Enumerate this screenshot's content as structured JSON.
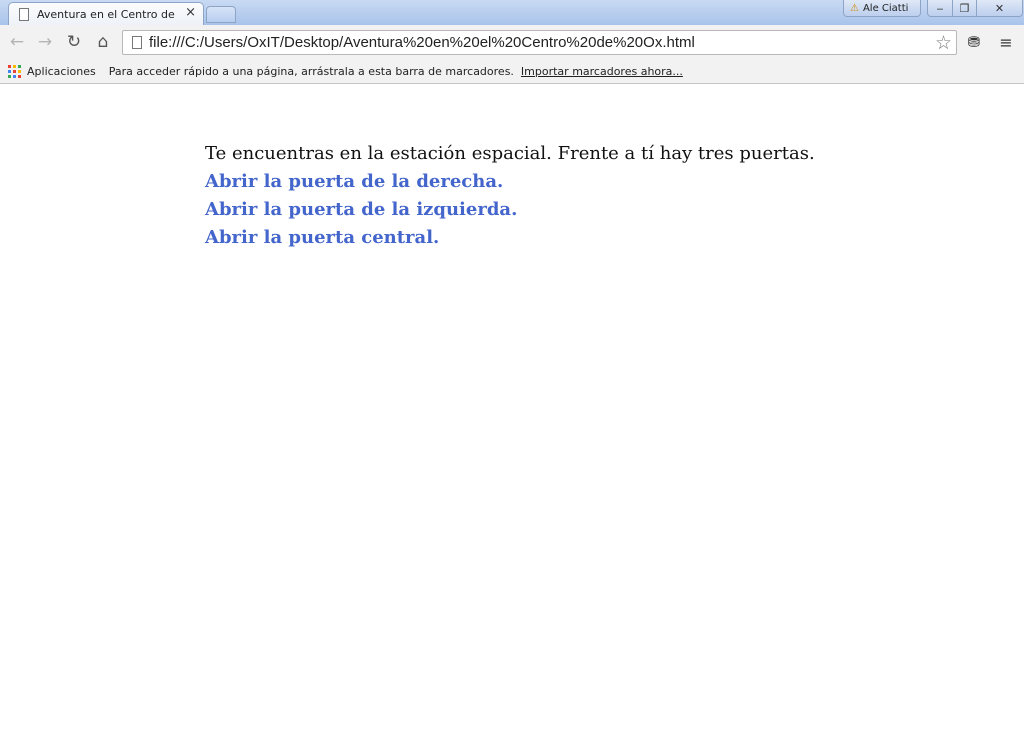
{
  "window": {
    "tab_title": "Aventura en el Centro de Ox",
    "tab_close": "×",
    "profile_name": "Ale Ciatti",
    "warning_glyph": "⚠",
    "minimize_glyph": "‒",
    "maximize_glyph": "❐",
    "close_glyph": "✕"
  },
  "toolbar": {
    "back_glyph": "←",
    "forward_glyph": "→",
    "reload_glyph": "↻",
    "home_glyph": "⌂",
    "url": "file:///C:/Users/OxIT/Desktop/Aventura%20en%20el%20Centro%20de%20Ox.html",
    "star_glyph": "☆",
    "extension_glyph": "⛃",
    "menu_glyph": "≡",
    "icons": [
      "back-icon",
      "forward-icon",
      "reload-icon",
      "home-icon",
      "page-icon",
      "star-icon",
      "extension-icon",
      "menu-icon"
    ]
  },
  "bookmarks": {
    "apps_label": "Aplicaciones",
    "hint": "Para acceder rápido a una página, arrástrala a esta barra de marcadores.",
    "import_link": "Importar marcadores ahora...",
    "apps_colors": [
      "#e94235",
      "#fbbc05",
      "#34a853",
      "#4285f4",
      "#e94235",
      "#fbbc05",
      "#34a853",
      "#4285f4",
      "#e94235"
    ]
  },
  "page": {
    "intro": "Te encuentras en la estación espacial. Frente a tí hay tres puertas.",
    "choices": [
      "Abrir la puerta de la derecha.",
      "Abrir la puerta de la izquierda.",
      "Abrir la puerta central."
    ],
    "link_color": "#4466cc"
  }
}
